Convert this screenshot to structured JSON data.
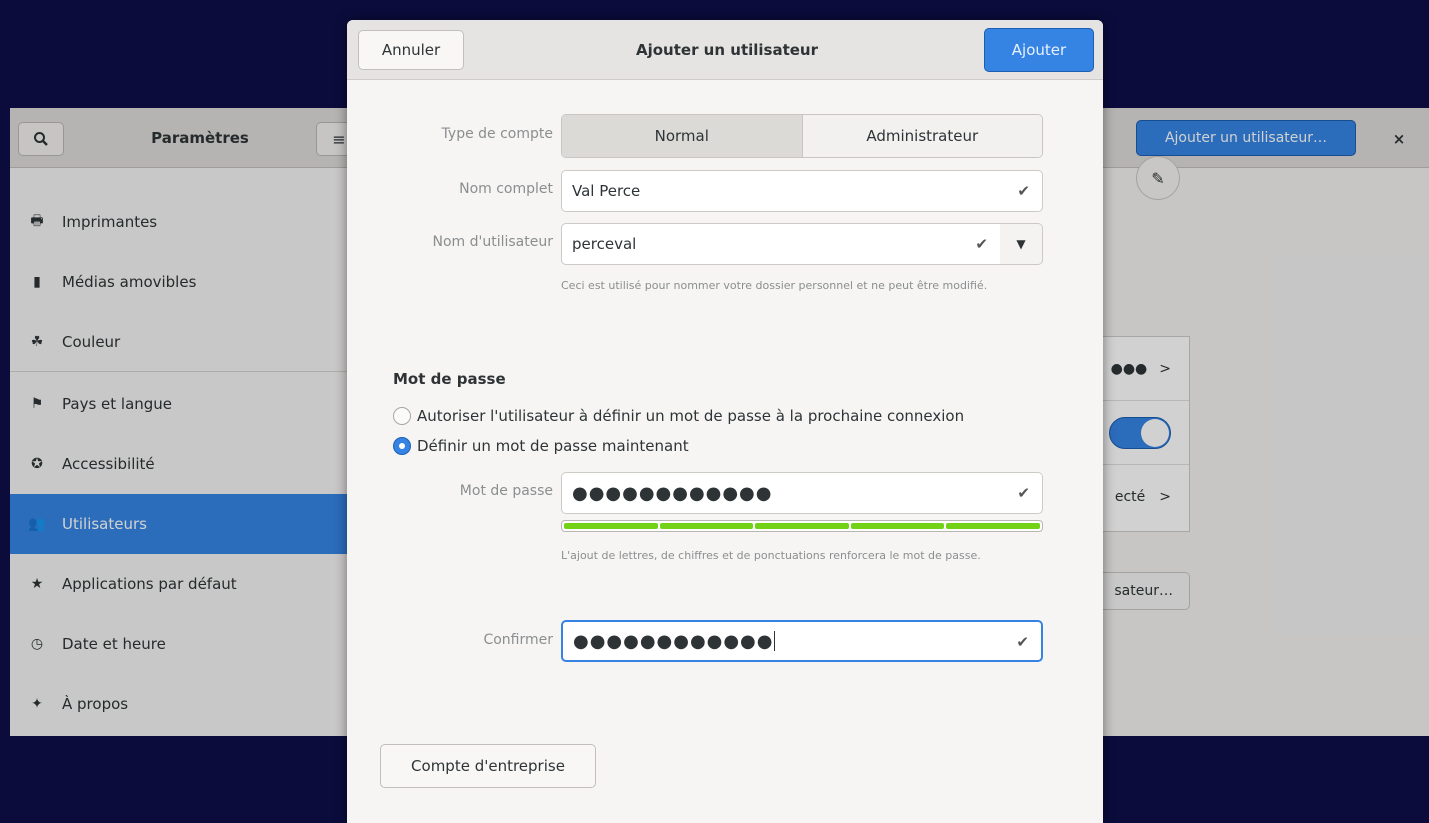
{
  "settings": {
    "title": "Paramètres",
    "add_user_button": "Ajouter un utilisateur…",
    "close_glyph": "×",
    "menu_glyph": "≡",
    "sidebar": {
      "items": [
        {
          "label": "Imprimantes",
          "icon": "printer-icon",
          "glyph": "🖶"
        },
        {
          "label": "Médias amovibles",
          "icon": "removable-media-icon",
          "glyph": "▮"
        },
        {
          "label": "Couleur",
          "icon": "color-icon",
          "glyph": "☘"
        },
        {
          "label": "Pays et langue",
          "icon": "flag-icon",
          "glyph": "⚑"
        },
        {
          "label": "Accessibilité",
          "icon": "accessibility-icon",
          "glyph": "✪"
        },
        {
          "label": "Utilisateurs",
          "icon": "users-icon",
          "glyph": "👥",
          "active": true
        },
        {
          "label": "Applications par défaut",
          "icon": "star-icon",
          "glyph": "★"
        },
        {
          "label": "Date et heure",
          "icon": "clock-icon",
          "glyph": "◷"
        },
        {
          "label": "À propos",
          "icon": "sparkle-icon",
          "glyph": "✦"
        }
      ]
    },
    "background_panel": {
      "password_dots": "●●●",
      "chevron": ">",
      "logged_text": "ecté",
      "other_user_button": "sateur…"
    }
  },
  "dialog": {
    "cancel": "Annuler",
    "title": "Ajouter un utilisateur",
    "add": "Ajouter",
    "account_type_label": "Type de compte",
    "account_type_options": [
      "Normal",
      "Administrateur"
    ],
    "account_type_selected": "Normal",
    "full_name_label": "Nom complet",
    "full_name_value": "Val Perce",
    "username_label": "Nom d'utilisateur",
    "username_value": "perceval",
    "username_hint": "Ceci est utilisé pour nommer votre dossier personnel et ne peut être modifié.",
    "password_section_title": "Mot de passe",
    "radio_option_1": "Autoriser l'utilisateur à définir un mot de passe à la prochaine connexion",
    "radio_option_2": "Définir un mot de passe maintenant",
    "radio_selected": 2,
    "password_label": "Mot de passe",
    "password_value": "●●●●●●●●●●●●",
    "password_strength": 1.0,
    "password_hint": "L'ajout de lettres, de chiffres et de ponctuations renforcera le mot de passe.",
    "confirm_label": "Confirmer",
    "confirm_value": "●●●●●●●●●●●●",
    "enterprise_button": "Compte d'entreprise",
    "check_glyph": "✔",
    "dropdown_glyph": "▼"
  },
  "colors": {
    "accent": "#3584e4",
    "strength": "#73d216",
    "desktop": "#0b0c3c"
  }
}
